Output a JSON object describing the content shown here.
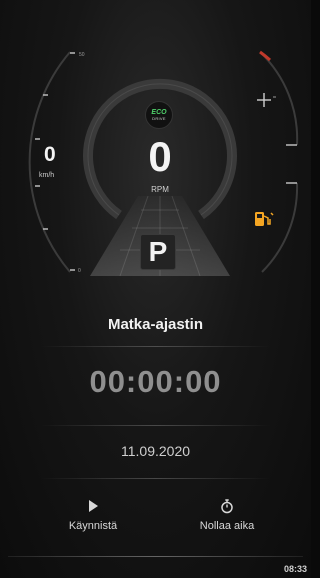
{
  "cluster": {
    "eco_label": "ECO",
    "eco_sub": "DRIVE",
    "rpm_value": "0",
    "rpm_label": "RPM",
    "speed_value": "0",
    "speed_unit": "km/h",
    "speed_scale_top": "50",
    "speed_scale_bottom": "0",
    "gear": "P",
    "fuel_icon_color": "#f5a623",
    "redline_color": "#c0392b"
  },
  "timer": {
    "title": "Matka-ajastin",
    "elapsed": "00:00:00",
    "date": "11.09.2020"
  },
  "actions": {
    "start_label": "Käynnistä",
    "start_icon": "play-icon",
    "reset_label": "Nollaa aika",
    "reset_icon": "stopwatch-icon"
  },
  "status": {
    "clock": "08:33"
  }
}
